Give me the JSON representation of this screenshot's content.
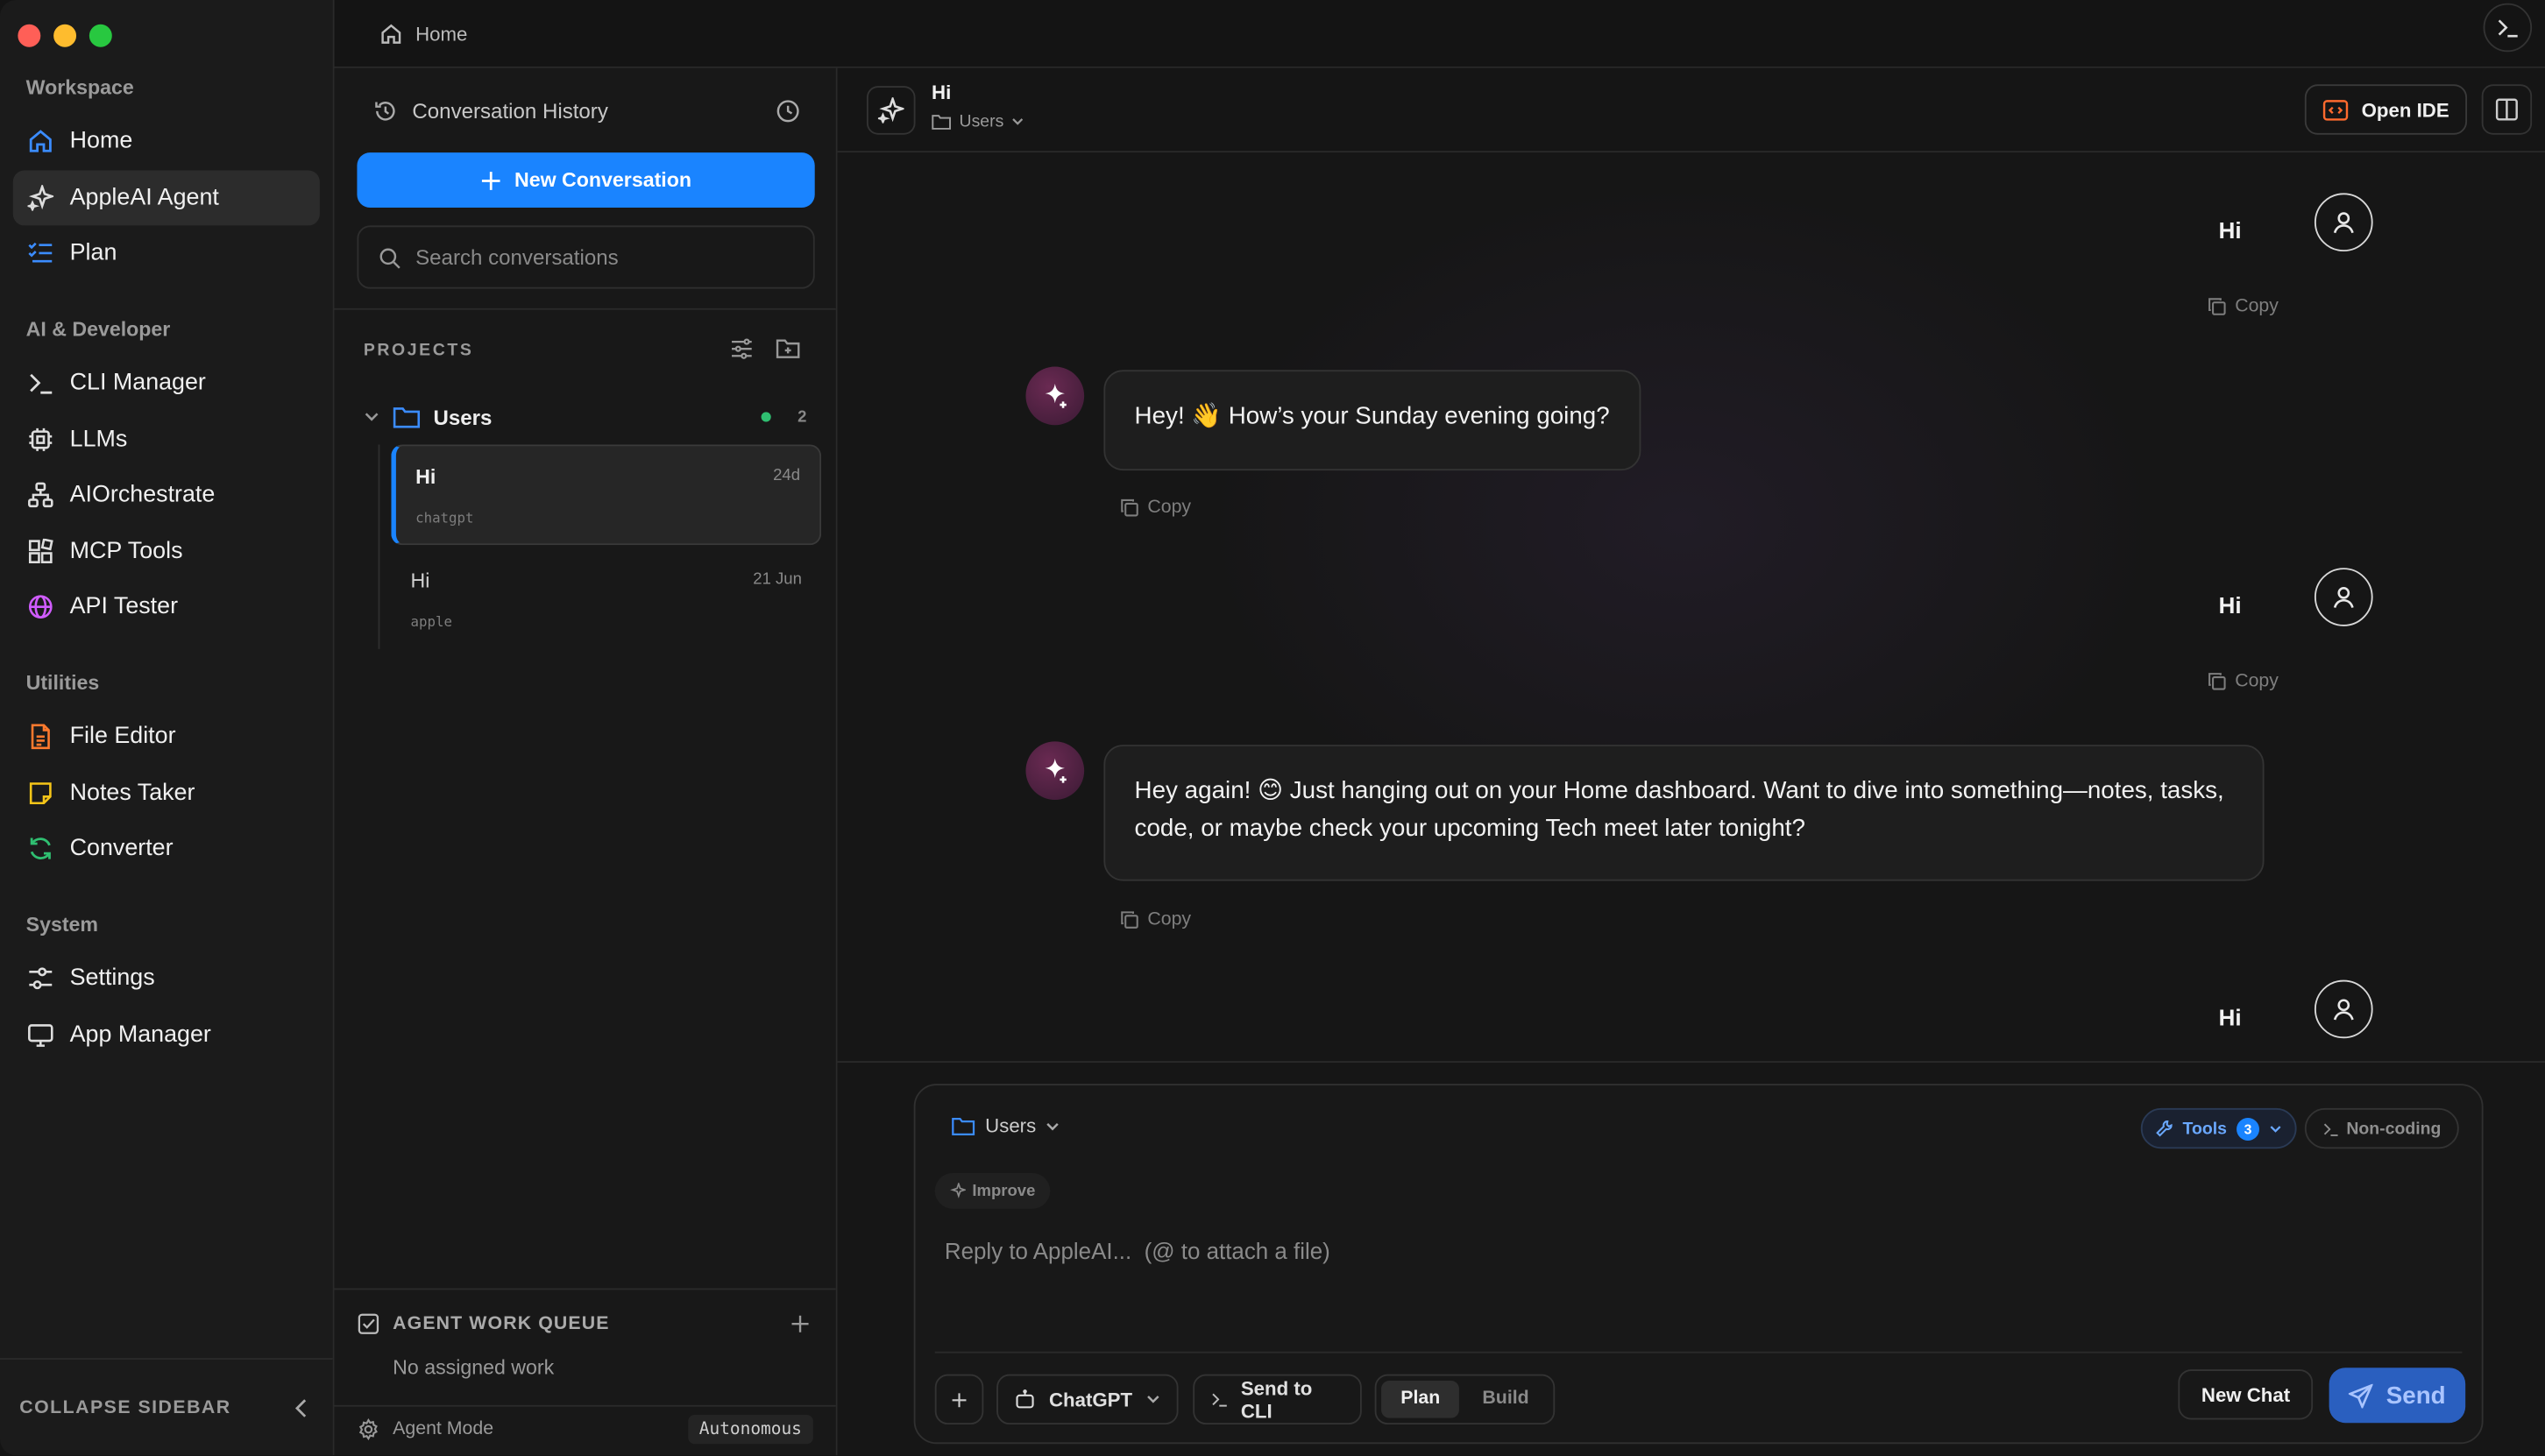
{
  "sidebar": {
    "sections": [
      {
        "label": "Workspace"
      },
      {
        "label": "AI & Developer"
      },
      {
        "label": "Utilities"
      },
      {
        "label": "System"
      }
    ],
    "items": [
      {
        "label": "Home",
        "icon": "home-icon",
        "color": "#3b8cff"
      },
      {
        "label": "AppleAI Agent",
        "icon": "sparkle-icon",
        "color": "#dddddd"
      },
      {
        "label": "Plan",
        "icon": "checklist-icon",
        "color": "#3b8cff"
      },
      {
        "label": "CLI Manager",
        "icon": "terminal-icon",
        "color": "#dddddd"
      },
      {
        "label": "LLMs",
        "icon": "chip-icon",
        "color": "#dddddd"
      },
      {
        "label": "AIOrchestrate",
        "icon": "network-icon",
        "color": "#dddddd"
      },
      {
        "label": "MCP Tools",
        "icon": "blocks-icon",
        "color": "#dddddd"
      },
      {
        "label": "API Tester",
        "icon": "globe-icon",
        "color": "#d05cff"
      },
      {
        "label": "File Editor",
        "icon": "file-icon",
        "color": "#ff7a2e"
      },
      {
        "label": "Notes Taker",
        "icon": "note-icon",
        "color": "#f5c518"
      },
      {
        "label": "Converter",
        "icon": "refresh-icon",
        "color": "#2fbf71"
      },
      {
        "label": "Settings",
        "icon": "sliders-icon",
        "color": "#dddddd"
      },
      {
        "label": "App Manager",
        "icon": "monitor-icon",
        "color": "#dddddd"
      }
    ],
    "collapse_label": "COLLAPSE SIDEBAR"
  },
  "breadcrumb": {
    "label": "Home"
  },
  "history": {
    "title": "Conversation History",
    "new_conversation": "New Conversation",
    "search_placeholder": "Search conversations",
    "projects_label": "PROJECTS",
    "project": {
      "name": "Users",
      "count": "2"
    },
    "conversations": [
      {
        "title": "Hi",
        "time": "24d",
        "model": "chatgpt"
      },
      {
        "title": "Hi",
        "time": "21 Jun",
        "model": "apple"
      }
    ],
    "queue_title": "AGENT WORK QUEUE",
    "queue_empty": "No assigned work",
    "agent_mode_label": "Agent Mode",
    "agent_mode_value": "Autonomous"
  },
  "chat": {
    "title": "Hi",
    "folder": "Users",
    "open_ide": "Open IDE",
    "messages": [
      {
        "role": "user",
        "text": "Hi",
        "copy": "Copy"
      },
      {
        "role": "assistant",
        "text": "Hey! 👋 How’s your Sunday evening going?",
        "copy": "Copy"
      },
      {
        "role": "user",
        "text": "Hi",
        "copy": "Copy"
      },
      {
        "role": "assistant",
        "text": "Hey again! 😊 Just hanging out on your Home dashboard. Want to dive into something—notes, tasks, code, or maybe check your upcoming Tech meet later tonight?",
        "copy": "Copy"
      },
      {
        "role": "user",
        "text": "Hi"
      }
    ]
  },
  "composer": {
    "folder": "Users",
    "tools_label": "Tools",
    "tools_count": "3",
    "noncoding_label": "Non-coding",
    "improve_label": "Improve",
    "placeholder": "Reply to AppleAI...  (@ to attach a file)",
    "model": "ChatGPT",
    "send_to_cli": "Send to CLI",
    "mode_plan": "Plan",
    "mode_build": "Build",
    "new_chat": "New Chat",
    "send": "Send"
  }
}
